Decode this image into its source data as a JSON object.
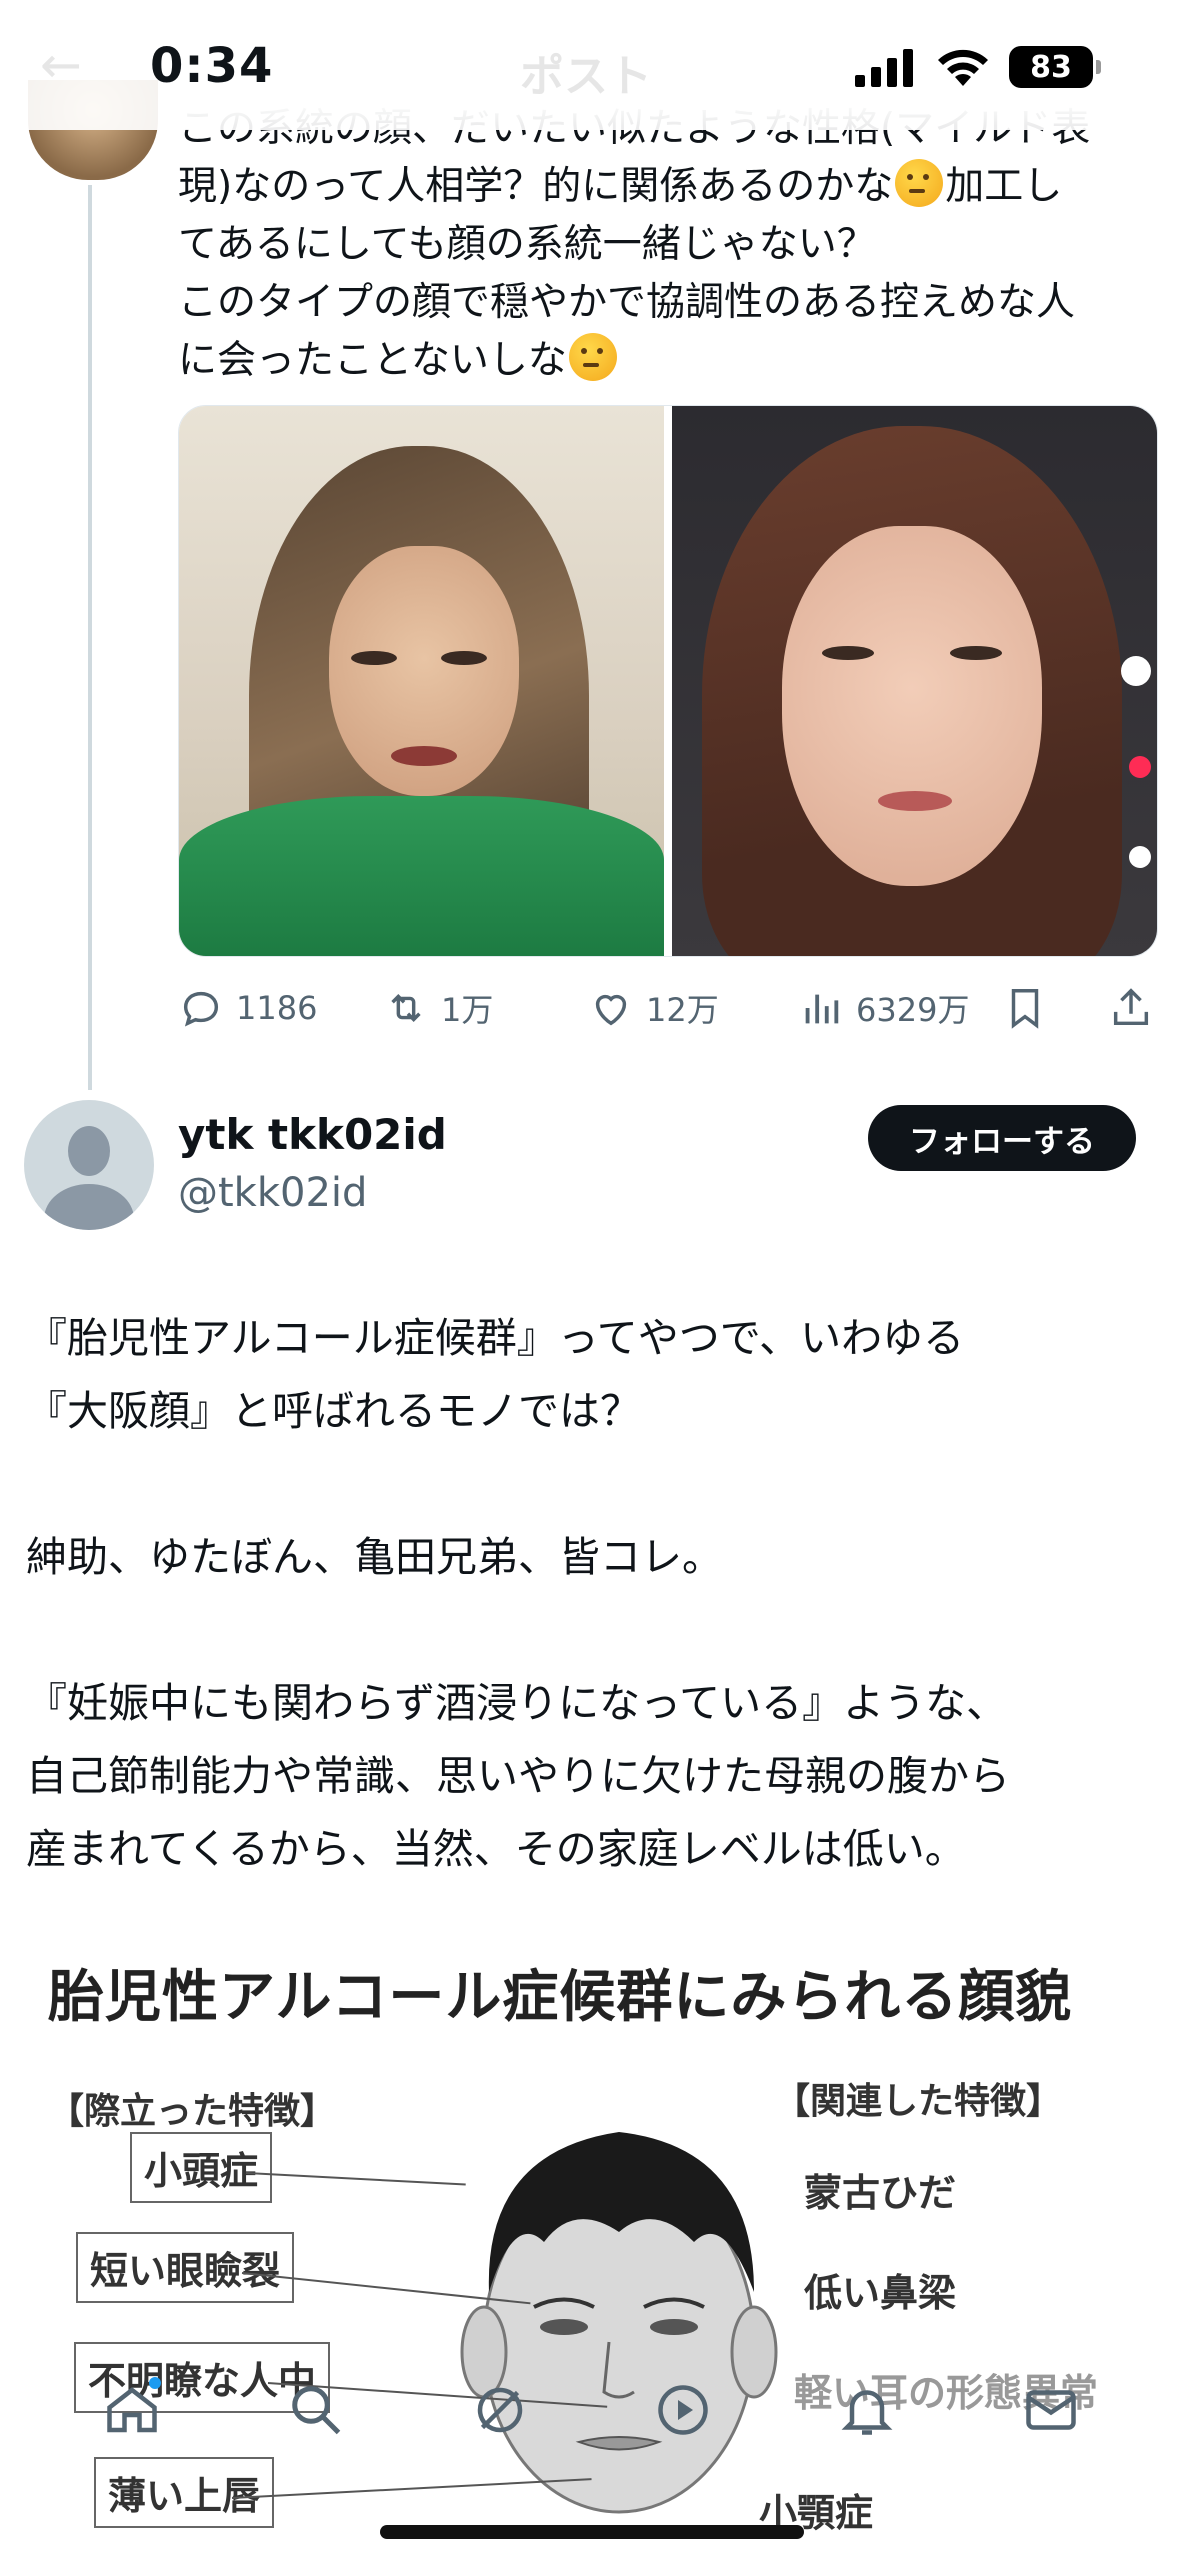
{
  "status_bar": {
    "time": "0:34",
    "battery": "83",
    "header_title": "ポスト"
  },
  "previous_post": {
    "lines": [
      "この系統の顔、だいたい似たような性格(マイルド表",
      "現)なのって人相学？的に関係あるのかな",
      "てあるにしても顔の系統一緒じゃない？",
      "このタイプの顔で穏やかで協調性のある控えめな人",
      "に会ったことないしな"
    ],
    "line2_suffix": "加工し",
    "stats": {
      "replies": "1186",
      "reposts": "1万",
      "likes": "12万",
      "views": "6329万"
    }
  },
  "main_post": {
    "display_name": "ytk tkk02id",
    "handle": "@tkk02id",
    "follow_label": "フォローする",
    "paragraphs": [
      "『胎児性アルコール症候群』ってやつで、いわゆる",
      "『大阪顔』と呼ばれるモノでは？",
      "",
      "紳助、ゆたぼん、亀田兄弟、皆コレ。",
      "",
      "『妊娠中にも関わらず酒浸りになっている』ような、",
      "自己節制能力や常識、思いやりに欠けた母親の腹から",
      "産まれてくるから、当然、その家庭レベルは低い。"
    ]
  },
  "figure": {
    "title": "胎児性アルコール症候群にみられる顔貌",
    "left_heading": "【際立った特徴】",
    "right_heading": "【関連した特徴】",
    "left_items": [
      "小頭症",
      "短い眼瞼裂",
      "不明瞭な人中",
      "薄い上唇"
    ],
    "right_items": [
      "蒙古ひだ",
      "低い鼻梁",
      "軽い耳の形態異常",
      "小顎症"
    ]
  },
  "nav": {
    "items": [
      "home-icon",
      "search-icon",
      "grok-icon",
      "video-icon",
      "notifications-icon",
      "messages-icon"
    ]
  },
  "colors": {
    "accent": "#1d9bf0",
    "text": "#0f1419",
    "muted": "#536471",
    "button_bg": "#0f1419"
  }
}
